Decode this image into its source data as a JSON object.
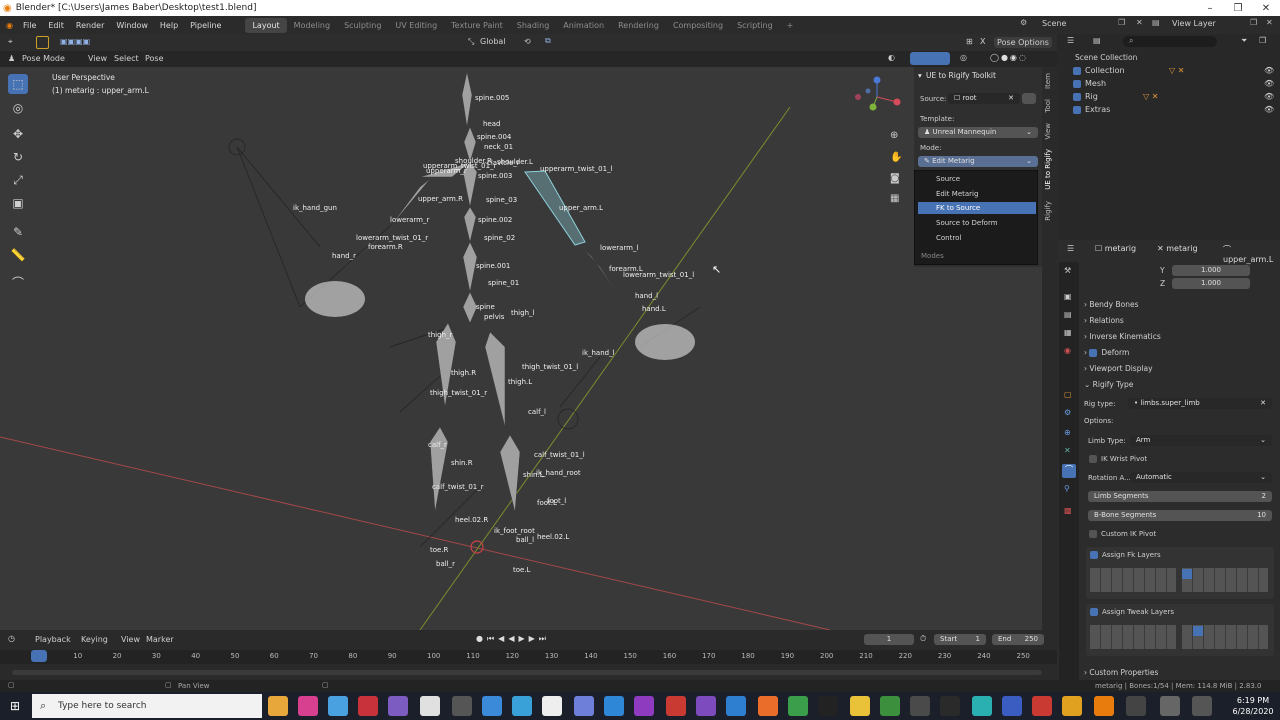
{
  "window": {
    "title": "Blender* [C:\\Users\\James Baber\\Desktop\\test1.blend]",
    "minimize": "–",
    "maximize": "❐",
    "close": "✕"
  },
  "menu": {
    "items": [
      "File",
      "Edit",
      "Render",
      "Window",
      "Help",
      "Pipeline"
    ]
  },
  "workspaces": [
    "Layout",
    "Modeling",
    "Sculpting",
    "UV Editing",
    "Texture Paint",
    "Shading",
    "Animation",
    "Rendering",
    "Compositing",
    "Scripting",
    "+"
  ],
  "scene": {
    "label": "Scene",
    "view_layer": "View Layer"
  },
  "header": {
    "orientation": "Global",
    "pose_options": "Pose Options"
  },
  "header2": {
    "mode": "Pose Mode",
    "view": "View",
    "select": "Select",
    "pose": "Pose"
  },
  "viewport": {
    "perspective": "User Perspective",
    "context": "(1) metarig : upper_arm.L"
  },
  "bones": [
    "spine.005",
    "head",
    "spine.004",
    "neck_01",
    "shoulder.R",
    "clavicle_r",
    "upperarm_twist_01_r",
    "upperarm_r",
    "shoulder.L",
    "upperarm_twist_01_l",
    "spine.003",
    "upper_arm.R",
    "spine_03",
    "upper_arm.L",
    "ik_hand_gun",
    "lowerarm_r",
    "spine.002",
    "lowerarm_twist_01_r",
    "forearm.R",
    "spine_02",
    "lowerarm_l",
    "hand_r",
    "forearm.L",
    "spine.001",
    "lowerarm_twist_01_l",
    "spine_01",
    "hand_l",
    "hand.L",
    "spine",
    "pelvis",
    "thigh_l",
    "thigh_r",
    "ik_hand_l",
    "thigh.R",
    "thigh_twist_01_l",
    "thigh.L",
    "thigh_twist_01_r",
    "calf_l",
    "calf_r",
    "calf_twist_01_l",
    "shin.R",
    "ik_hand_root",
    "shin.L",
    "calf_twist_01_r",
    "foot_l",
    "foot.L",
    "heel.02.R",
    "ik_foot_root",
    "ball_l",
    "heel.02.L",
    "toe.R",
    "ball_r",
    "toe.L"
  ],
  "npanel": {
    "title": "UE to Rigify Toolkit",
    "source_label": "Source:",
    "source_value": "root",
    "template_label": "Template:",
    "template_value": "Unreal Mannequin",
    "mode_label": "Mode:",
    "mode_value": "Edit Metarig"
  },
  "dropdown": {
    "items": [
      "Source",
      "Edit Metarig",
      "FK to Source",
      "Source to Deform",
      "Control"
    ],
    "selected_index": 2,
    "footer": "Modes"
  },
  "ntabs": [
    "Item",
    "Tool",
    "View",
    "UE to Rigify",
    "Rigify"
  ],
  "outliner": {
    "root": "Scene Collection",
    "items": [
      "Collection",
      "Mesh",
      "Rig",
      "Extras"
    ]
  },
  "props_header": {
    "object": "metarig",
    "armature": "metarig",
    "bone": "upper_arm.L"
  },
  "props": {
    "y_label": "Y",
    "y_value": "1.000",
    "z_label": "Z",
    "z_value": "1.000",
    "sections": [
      "Bendy Bones",
      "Relations",
      "Inverse Kinematics",
      "Deform",
      "Viewport Display",
      "Rigify Type"
    ],
    "rig_type_label": "Rig type:",
    "rig_type_value": "limbs.super_limb",
    "options_label": "Options:",
    "limb_type_label": "Limb Type:",
    "limb_type_value": "Arm",
    "ik_wrist_pivot": "IK Wrist Pivot",
    "rotation_label": "Rotation A...",
    "rotation_value": "Automatic",
    "limb_segments_label": "Limb Segments",
    "limb_segments_value": "2",
    "bbone_segments_label": "B-Bone Segments",
    "bbone_segments_value": "10",
    "custom_ik_pivot": "Custom IK Pivot",
    "assign_fk": "Assign Fk Layers",
    "assign_tweak": "Assign Tweak Layers",
    "custom_properties": "Custom Properties"
  },
  "timeline": {
    "playback": "Playback",
    "keying": "Keying",
    "view": "View",
    "marker": "Marker",
    "current": "1",
    "start_label": "Start",
    "start": "1",
    "end_label": "End",
    "end": "250",
    "ticks": [
      "1",
      "10",
      "20",
      "30",
      "40",
      "50",
      "60",
      "70",
      "80",
      "90",
      "100",
      "110",
      "120",
      "130",
      "140",
      "150",
      "160",
      "170",
      "180",
      "190",
      "200",
      "210",
      "220",
      "230",
      "240",
      "250"
    ]
  },
  "status": {
    "pan": "Pan View",
    "info": "metarig | Bones:1/54 | Mem: 114.8 MiB | 2.83.0"
  },
  "taskbar": {
    "search_placeholder": "Type here to search",
    "time": "6:19 PM",
    "date": "6/28/2020"
  },
  "colors": {
    "accent": "#4772b3",
    "selected_bone": "#8fd0dc",
    "bone": "#a0a0a0"
  }
}
